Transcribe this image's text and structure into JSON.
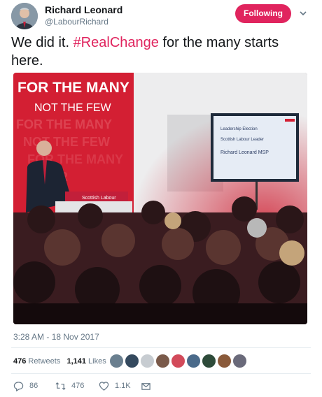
{
  "author": {
    "name": "Richard Leonard",
    "handle": "@LabourRichard"
  },
  "follow_button": {
    "label": "Following",
    "color": "#e0245e"
  },
  "tweet": {
    "text_before": "We did it. ",
    "hashtag": "#RealChange",
    "text_after": " for the many starts here."
  },
  "photo": {
    "banner_line1": "FOR THE MANY",
    "banner_line2": "NOT THE FEW",
    "podium_label": "Scottish Labour",
    "screen_line1": "Leadership Election",
    "screen_line2": "Scottish Labour Leader",
    "screen_line3": "Richard Leonard MSP"
  },
  "timestamp": "3:28 AM - 18 Nov 2017",
  "stats": {
    "retweets_count": "476",
    "retweets_label": "Retweets",
    "likes_count": "1,141",
    "likes_label": "Likes"
  },
  "likers": [
    "#6a7f8f",
    "#34495e",
    "#c7ccd1",
    "#7a5a4a",
    "#d24a5a",
    "#4a6a8a",
    "#2e4b3a",
    "#8a5a3a",
    "#6a6a7a"
  ],
  "actions": {
    "reply_count": "86",
    "retweet_count": "476",
    "like_count": "1.1K"
  },
  "icons": {
    "reply": "reply-icon",
    "retweet": "retweet-icon",
    "like": "heart-icon",
    "dm": "envelope-icon",
    "more": "chevron-down-icon"
  }
}
